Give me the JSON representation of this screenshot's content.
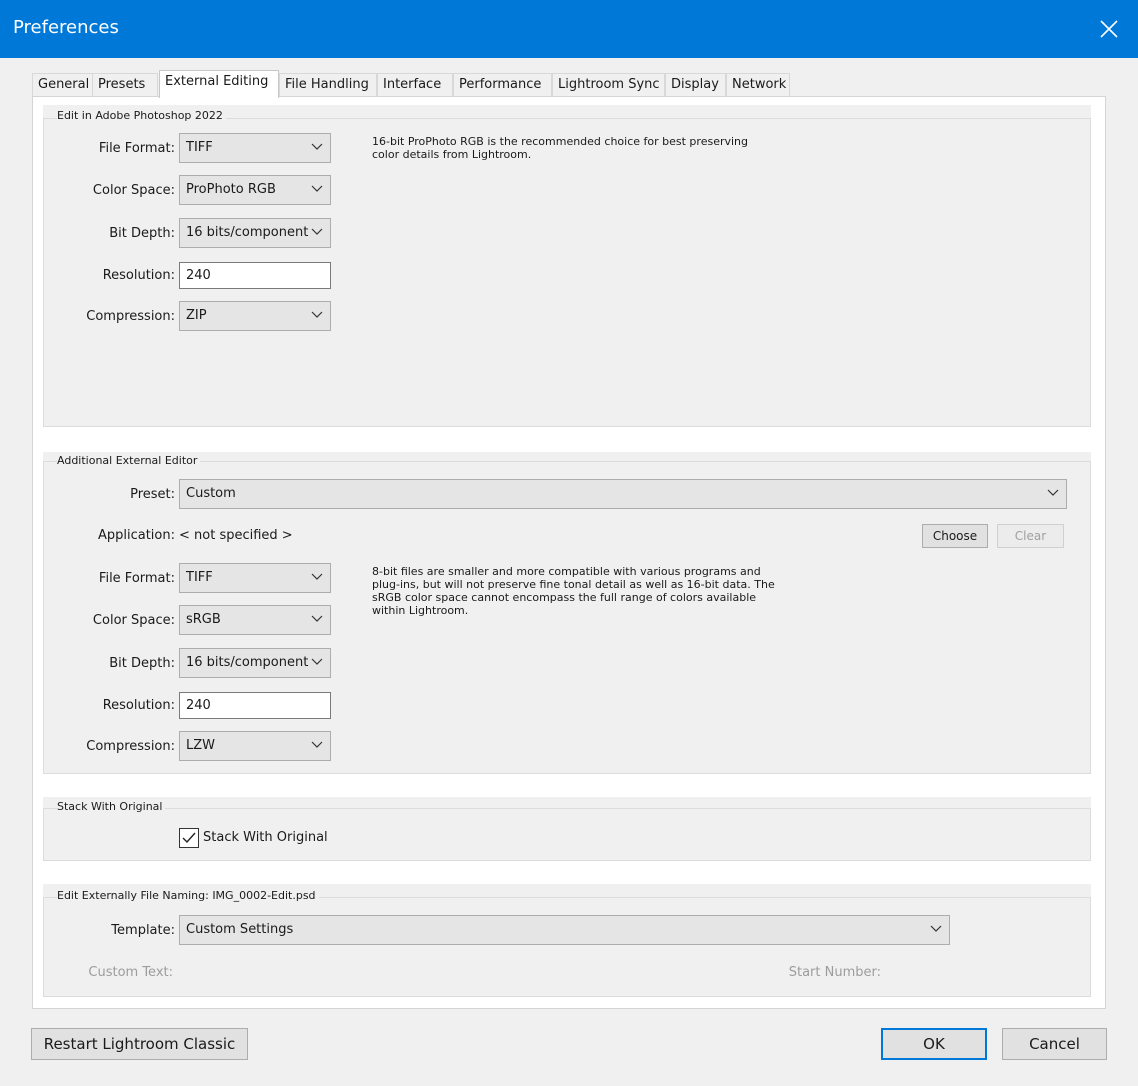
{
  "window": {
    "title": "Preferences"
  },
  "tabs": [
    "General",
    "Presets",
    "External Editing",
    "File Handling",
    "Interface",
    "Performance",
    "Lightroom Sync",
    "Display",
    "Network"
  ],
  "photoshop": {
    "group_label": "Edit in Adobe Photoshop 2022",
    "file_format_label": "File Format:",
    "file_format": "TIFF",
    "color_space_label": "Color Space:",
    "color_space": "ProPhoto RGB",
    "bit_depth_label": "Bit Depth:",
    "bit_depth": "16 bits/component",
    "resolution_label": "Resolution:",
    "resolution": "240",
    "compression_label": "Compression:",
    "compression": "ZIP",
    "note": "16-bit ProPhoto RGB is the recommended choice for best preserving color details from Lightroom."
  },
  "additional": {
    "group_label": "Additional External Editor",
    "preset_label": "Preset:",
    "preset": "Custom",
    "application_label": "Application:",
    "application": "< not specified >",
    "choose_label": "Choose",
    "clear_label": "Clear",
    "file_format_label": "File Format:",
    "file_format": "TIFF",
    "color_space_label": "Color Space:",
    "color_space": "sRGB",
    "bit_depth_label": "Bit Depth:",
    "bit_depth": "16 bits/component",
    "resolution_label": "Resolution:",
    "resolution": "240",
    "compression_label": "Compression:",
    "compression": "LZW",
    "note": "8-bit files are smaller and more compatible with various programs and plug-ins, but will not preserve fine tonal detail as well as 16-bit data. The sRGB color space cannot encompass the full range of colors available within Lightroom."
  },
  "stack": {
    "group_label": "Stack With Original",
    "checkbox_label": "Stack With Original",
    "checked": true
  },
  "naming": {
    "group_label": "Edit Externally File Naming:",
    "example": "IMG_0002-Edit.psd",
    "template_label": "Template:",
    "template": "Custom Settings",
    "custom_text_label": "Custom Text:",
    "start_number_label": "Start Number:"
  },
  "footer": {
    "restart_label": "Restart Lightroom Classic",
    "ok_label": "OK",
    "cancel_label": "Cancel"
  },
  "colors": {
    "titlebar": "#0078d7",
    "dialog_bg": "#f0f0f0",
    "default_button_border": "#0078d7"
  }
}
